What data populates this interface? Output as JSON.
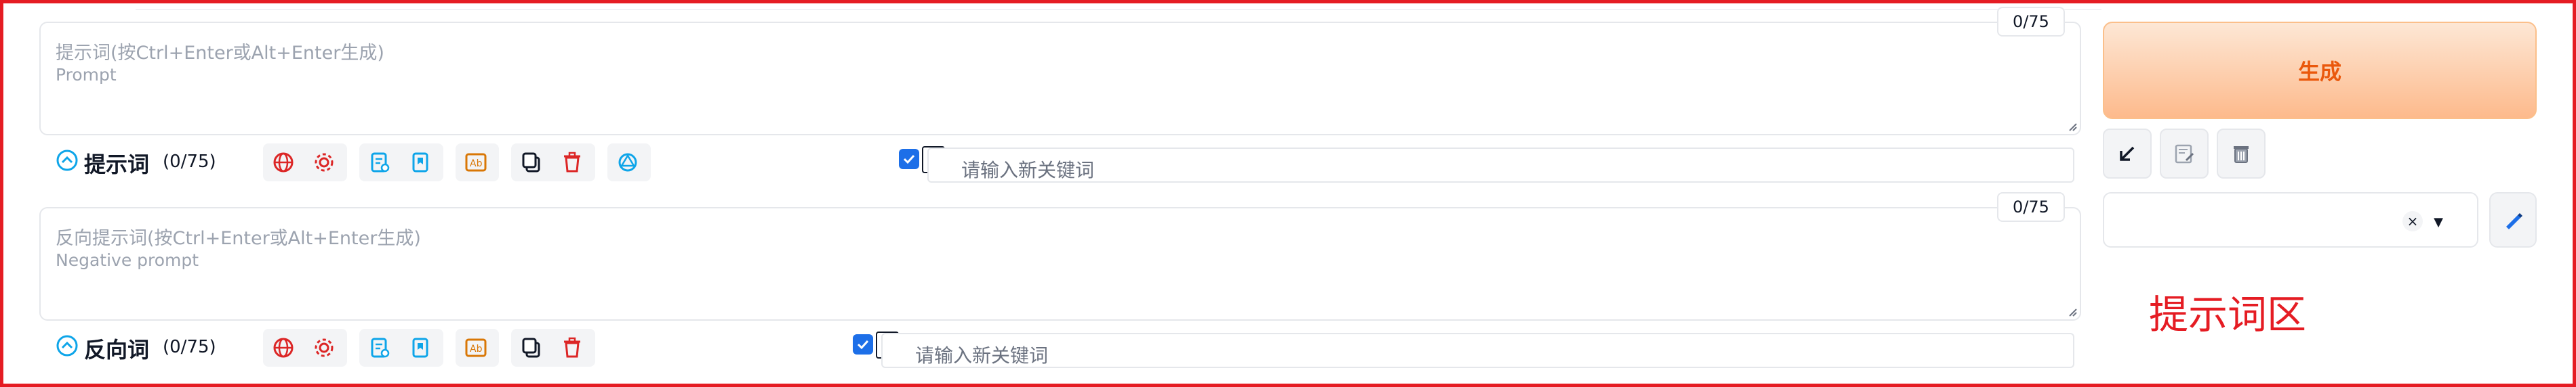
{
  "positive": {
    "placeholder_line1": "提示词(按Ctrl+Enter或Alt+Enter生成)",
    "placeholder_line2": "Prompt",
    "counter": "0/75",
    "title": "提示词",
    "count": "(0/75)",
    "keyword_placeholder": "请输入新关键词",
    "keyword_checked": true
  },
  "negative": {
    "placeholder_line1": "反向提示词(按Ctrl+Enter或Alt+Enter生成)",
    "placeholder_line2": "Negative prompt",
    "counter": "0/75",
    "title": "反向词",
    "count": "(0/75)",
    "keyword_placeholder": "请输入新关键词",
    "keyword_checked": true
  },
  "sidebar": {
    "generate_label": "生成",
    "style_dropdown_value": ""
  },
  "annotation": "提示词区",
  "colors": {
    "frame": "#e51c23",
    "generate_text": "#ea580c",
    "translate_icon": "#dc2626",
    "doc_icon": "#0ea5e9",
    "ab_icon": "#d97706",
    "checkbox": "#1d6fe8"
  },
  "icons": [
    "chevron-up-icon",
    "globe-icon",
    "gear-icon",
    "doc-load-icon",
    "bookmark-icon",
    "ab-swap-icon",
    "copy-icon",
    "trash-icon",
    "openai-icon",
    "arrow-down-left-icon",
    "clipboard-edit-icon",
    "trash-can-icon",
    "pencil-icon"
  ]
}
